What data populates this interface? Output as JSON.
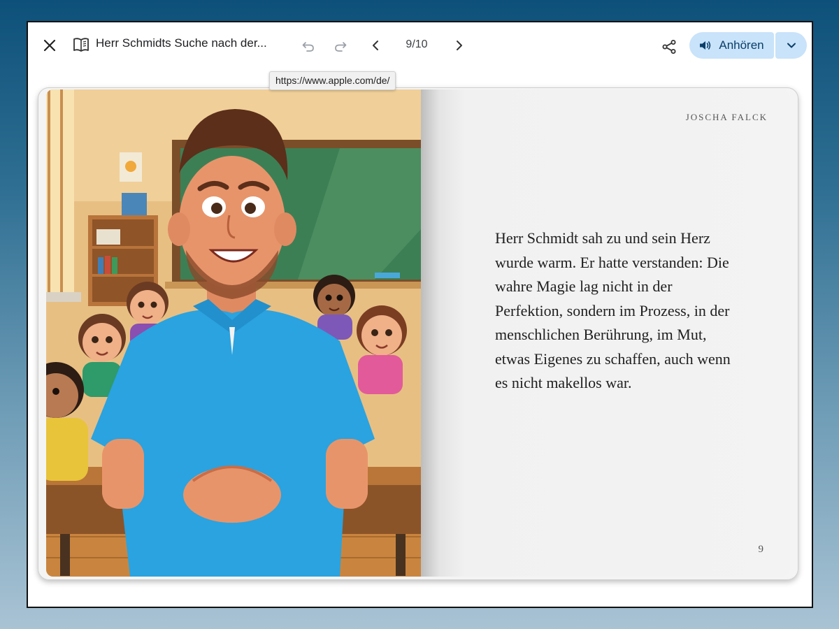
{
  "toolbar": {
    "close_icon": "close-icon",
    "book_icon": "open-book-icon",
    "title": "Herr Schmidts Suche nach der...",
    "undo_icon": "undo-icon",
    "redo_icon": "redo-icon",
    "prev_icon": "chevron-left-icon",
    "next_icon": "chevron-right-icon",
    "page_counter": "9/10",
    "share_icon": "share-icon",
    "listen_label": "Anhören",
    "listen_icon": "speaker-icon",
    "listen_dropdown_icon": "chevron-down-icon",
    "accent_color": "#c8e3fa"
  },
  "tooltip": {
    "text": "https://www.apple.com/de/"
  },
  "book": {
    "author": "JOSCHA FALCK",
    "text": "Herr Schmidt sah zu und sein Herz wurde warm. Er hatte verstanden: Die wahre Magie lag nicht in der Perfektion, sondern im Prozess, in der menschlichen Berührung, im Mut, etwas Eigenes zu schaffen, auch wenn es nicht makellos war.",
    "page_number": "9",
    "illustration": "classroom-teacher-illustration"
  }
}
